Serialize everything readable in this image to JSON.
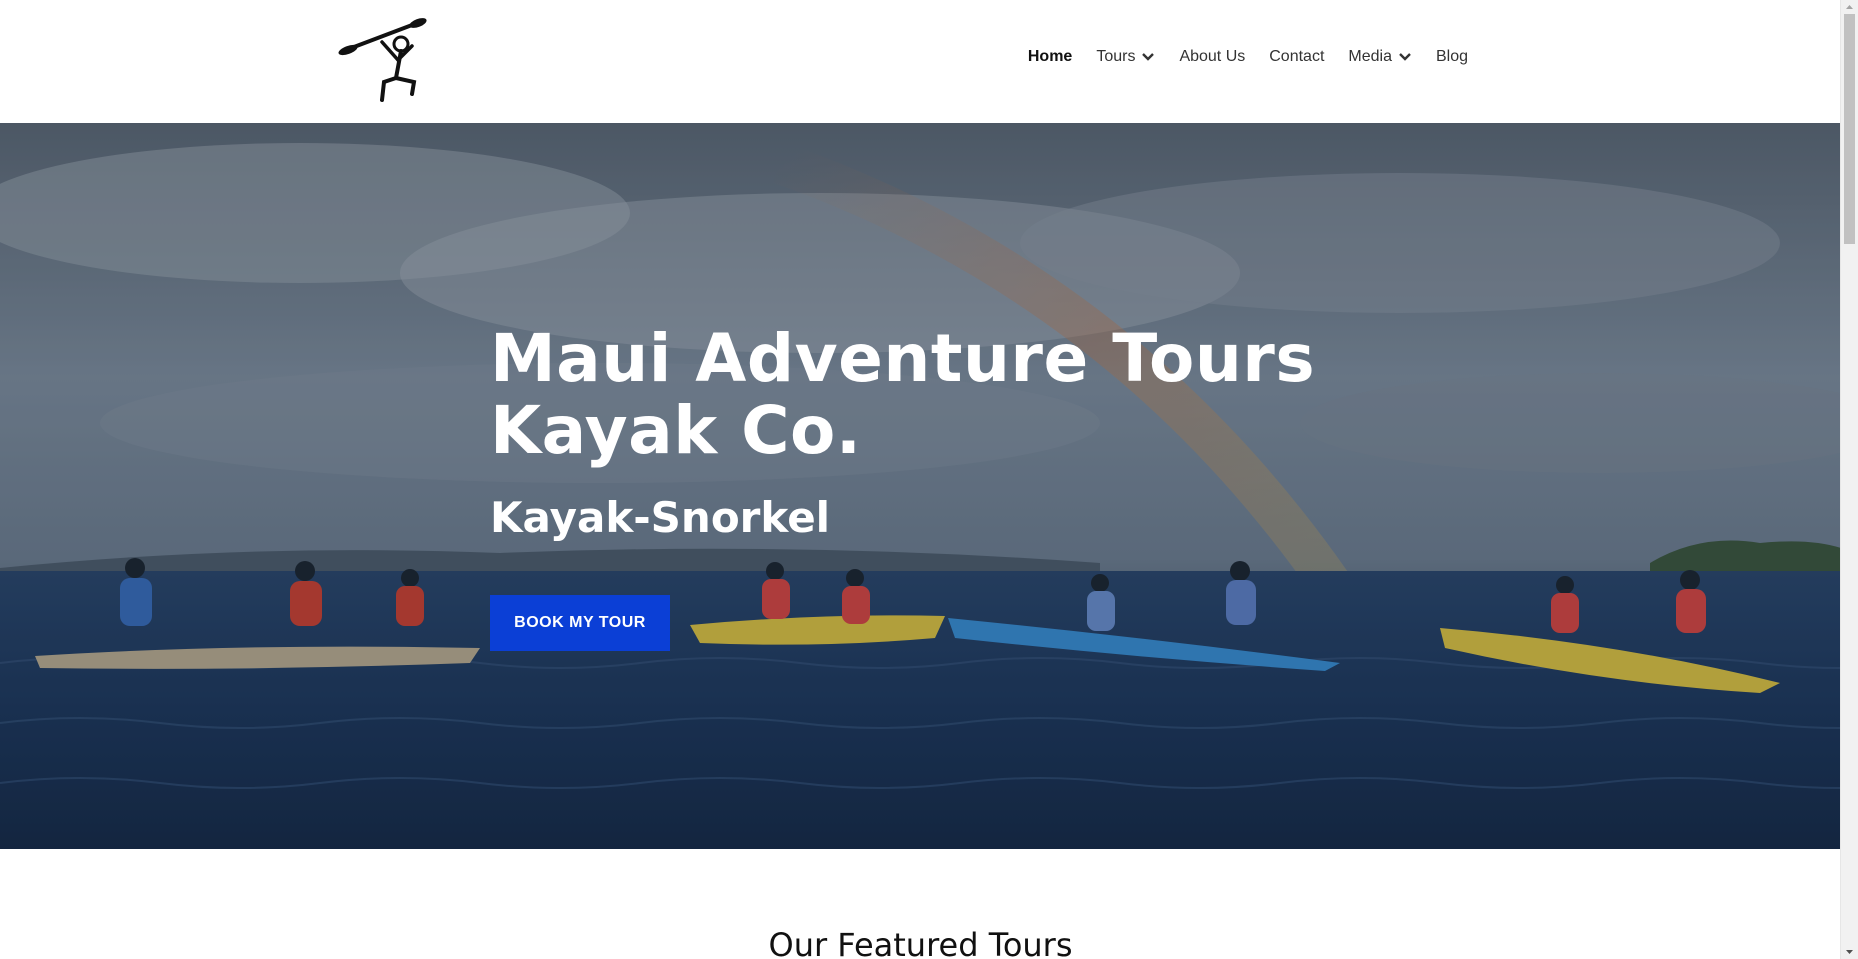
{
  "header": {
    "logo_icon": "kayaker-stick-figure-logo",
    "nav": [
      {
        "label": "Home",
        "active": true,
        "has_dropdown": false
      },
      {
        "label": "Tours",
        "active": false,
        "has_dropdown": true
      },
      {
        "label": "About Us",
        "active": false,
        "has_dropdown": false
      },
      {
        "label": "Contact",
        "active": false,
        "has_dropdown": false
      },
      {
        "label": "Media",
        "active": false,
        "has_dropdown": true
      },
      {
        "label": "Blog",
        "active": false,
        "has_dropdown": false
      }
    ]
  },
  "hero": {
    "title_line1": "Maui Adventure Tours",
    "title_line2": "Kayak Co.",
    "subtitle": "Kayak-Snorkel",
    "cta_label": "BOOK MY TOUR",
    "background": "photo-of-kayakers-on-ocean-with-rainbow"
  },
  "featured": {
    "title": "Our Featured Tours"
  },
  "colors": {
    "accent": "#0b3fd6",
    "hero_text": "#ffffff",
    "ocean": "#1f3f68",
    "sky": "#7a8ea3"
  }
}
